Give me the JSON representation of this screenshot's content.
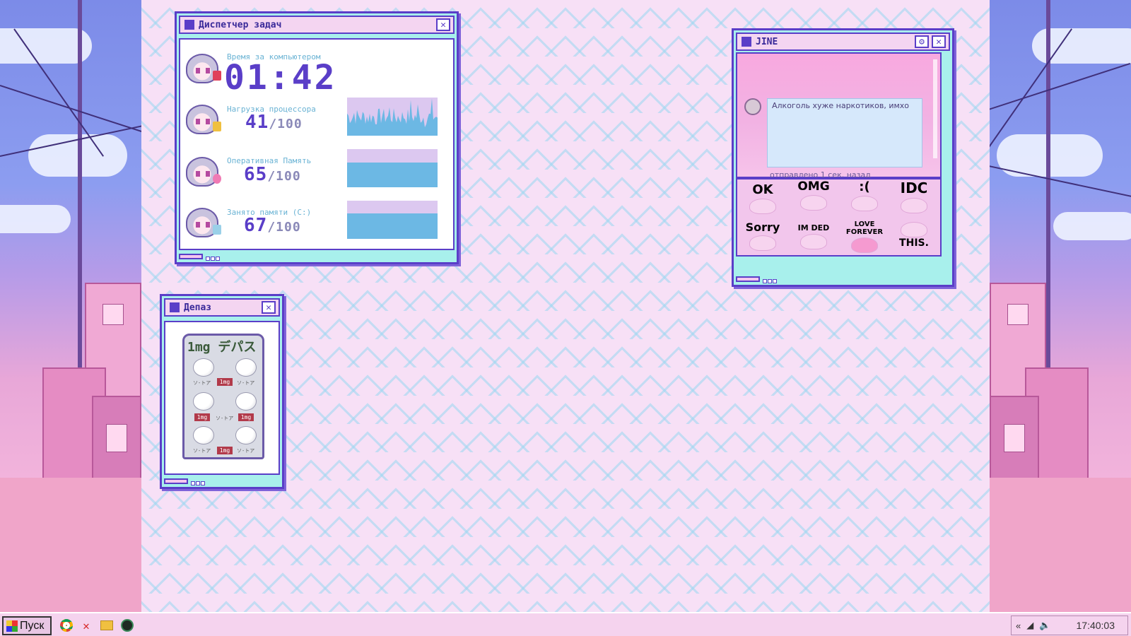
{
  "task_manager": {
    "title": "Диспетчер задач",
    "close_glyph": "✕",
    "screen_time_label": "Время за компьютером",
    "screen_time_value": "01:42",
    "cpu_label": "Нагрузка процессора",
    "cpu_value": "41",
    "cpu_percent": 41,
    "ram_label": "Оперативная Память",
    "ram_value": "65",
    "ram_percent": 65,
    "disk_label": "Занято памяти (C:)",
    "disk_value": "67",
    "disk_percent": 67,
    "max_text": "/100"
  },
  "depaz": {
    "title": "Депаз",
    "close_glyph": "✕",
    "blister_header": "1mg デパス",
    "dose_label": "1mg",
    "pill_tag": "ソ-トア"
  },
  "jine": {
    "title": "JINE",
    "settings_glyph": "⚙",
    "close_glyph": "✕",
    "message_text": "Алкоголь хуже наркотиков, имхо",
    "sent_text": "отправлено 1 сек. назад",
    "stickers": [
      {
        "label": "OK",
        "color": "#f3a7b9"
      },
      {
        "label": "OMG",
        "color": "#f6a98c"
      },
      {
        "label": ":(",
        "color": "#c9a9e0"
      },
      {
        "label": "IDC",
        "color": "#9a94c8"
      },
      {
        "label": "Sorry",
        "color": "#a79ab8"
      },
      {
        "label": "IM DED",
        "color": "#8d8aa8"
      },
      {
        "label": "LOVE FOREVER",
        "color": "#e65aa6"
      },
      {
        "label": "THIS.",
        "color": "#d9a8d6"
      }
    ]
  },
  "taskbar": {
    "start_label": "Пуск",
    "icons": [
      "chrome-icon",
      "antivirus-icon",
      "folder-icon",
      "activity-monitor-icon"
    ],
    "tray_arrows": "«",
    "clock": "17:40:03"
  },
  "colors": {
    "accent": "#5a3ec8",
    "frame": "#a8f0ec",
    "graph_fill": "#6cb8e4",
    "graph_bg": "#dcc8f0",
    "desktop_bg": "#f7e0f6"
  }
}
